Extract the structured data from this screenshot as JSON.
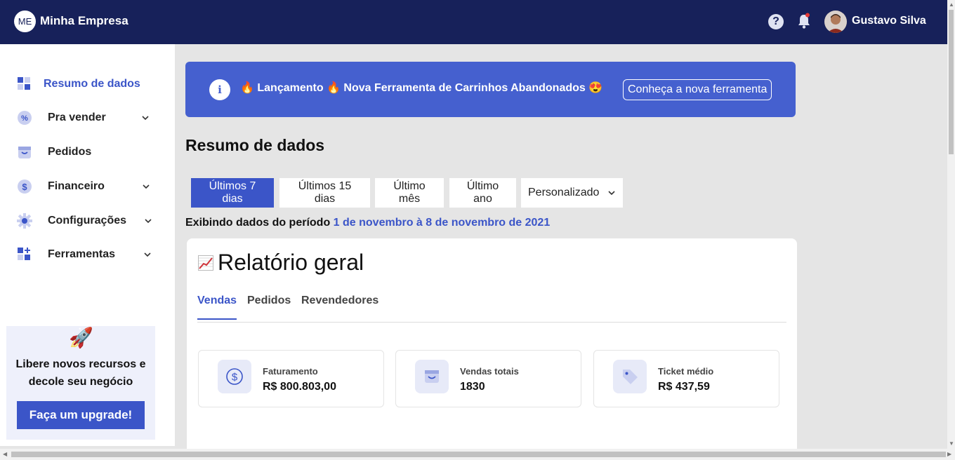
{
  "header": {
    "logo_initials": "ME",
    "brand": "Minha Empresa",
    "user_name": "Gustavo Silva"
  },
  "sidebar": {
    "items": [
      {
        "label": "Resumo de dados",
        "icon": "grid-icon",
        "active": true
      },
      {
        "label": "Pra vender",
        "icon": "percent-icon",
        "expandable": true
      },
      {
        "label": "Pedidos",
        "icon": "bag-icon"
      },
      {
        "label": "Financeiro",
        "icon": "dollar-icon",
        "expandable": true
      },
      {
        "label": "Configurações",
        "icon": "gear-icon",
        "expandable": true
      },
      {
        "label": "Ferramentas",
        "icon": "tools-icon",
        "expandable": true
      }
    ],
    "upgrade": {
      "icon": "🚀",
      "text_line1": "Libere novos recursos e",
      "text_line2": "decole seu negócio",
      "button": "Faça um upgrade!"
    }
  },
  "banner": {
    "text": "🔥 Lançamento 🔥 Nova Ferramenta de Carrinhos Abandonados 😍",
    "button": "Conheça a nova ferramenta"
  },
  "main": {
    "title": "Resumo de dados",
    "periods": [
      "Últimos 7 dias",
      "Últimos 15 dias",
      "Último mês",
      "Último ano",
      "Personalizado"
    ],
    "active_period": "Últimos 7 dias",
    "period_prefix": "Exibindo dados do período",
    "period_range": "1 de novembro à 8 de novembro de 2021"
  },
  "report": {
    "title": "Relatório geral",
    "tabs": [
      "Vendas",
      "Pedidos",
      "Revendedores"
    ],
    "active_tab": "Vendas",
    "stats": [
      {
        "label": "Faturamento",
        "value": "R$ 800.803,00",
        "icon": "dollar-icon"
      },
      {
        "label": "Vendas totais",
        "value": "1830",
        "icon": "bag-icon"
      },
      {
        "label": "Ticket médio",
        "value": "R$ 437,59",
        "icon": "tag-icon"
      }
    ]
  },
  "colors": {
    "header_bg": "#17215a",
    "accent": "#3b55c8",
    "banner_bg": "#4560cf"
  }
}
